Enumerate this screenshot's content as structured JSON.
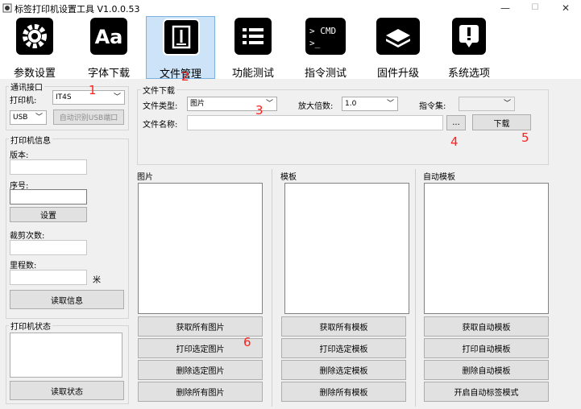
{
  "window": {
    "title": "标签打印机设置工具  V1.0.0.53",
    "min": "—",
    "max": "☐",
    "close": "✕"
  },
  "toolbar": [
    {
      "label": "参数设置",
      "icon": "gear-icon"
    },
    {
      "label": "字体下载",
      "icon": "font-icon"
    },
    {
      "label": "文件管理",
      "icon": "file-pencil-icon"
    },
    {
      "label": "功能测试",
      "icon": "list-icon"
    },
    {
      "label": "指令测试",
      "icon": "cmd-icon"
    },
    {
      "label": "固件升级",
      "icon": "chip-icon"
    },
    {
      "label": "系统选项",
      "icon": "alert-icon"
    }
  ],
  "left": {
    "comm_title": "通讯接口",
    "printer_label": "打印机:",
    "printer_value": "IT4S",
    "port_value": "USB",
    "auto_detect": "自动识别USB端口",
    "info_title": "打印机信息",
    "version_label": "版本:",
    "serial_label": "序号:",
    "set_button": "设置",
    "cut_label": "裁剪次数:",
    "mileage_label": "里程数:",
    "mileage_unit": "米",
    "read_info": "读取信息",
    "status_title": "打印机状态",
    "read_status": "读取状态"
  },
  "download": {
    "title": "文件下载",
    "type_label": "文件类型:",
    "type_value": "图片",
    "zoom_label": "放大倍数:",
    "zoom_value": "1.0",
    "cmdset_label": "指令集:",
    "cmdset_value": "",
    "name_label": "文件名称:",
    "name_value": "",
    "browse": "...",
    "download_btn": "下载"
  },
  "images": {
    "title": "图片",
    "buttons": [
      "获取所有图片",
      "打印选定图片",
      "删除选定图片",
      "删除所有图片"
    ]
  },
  "templates": {
    "title": "模板",
    "buttons": [
      "获取所有模板",
      "打印选定模板",
      "删除选定模板",
      "删除所有模板"
    ]
  },
  "auto": {
    "title": "自动模板",
    "buttons": [
      "获取自动模板",
      "打印自动模板",
      "删除自动模板",
      "开启自动标签模式"
    ]
  },
  "annotations": [
    "1",
    "2",
    "3",
    "4",
    "5",
    "6"
  ]
}
